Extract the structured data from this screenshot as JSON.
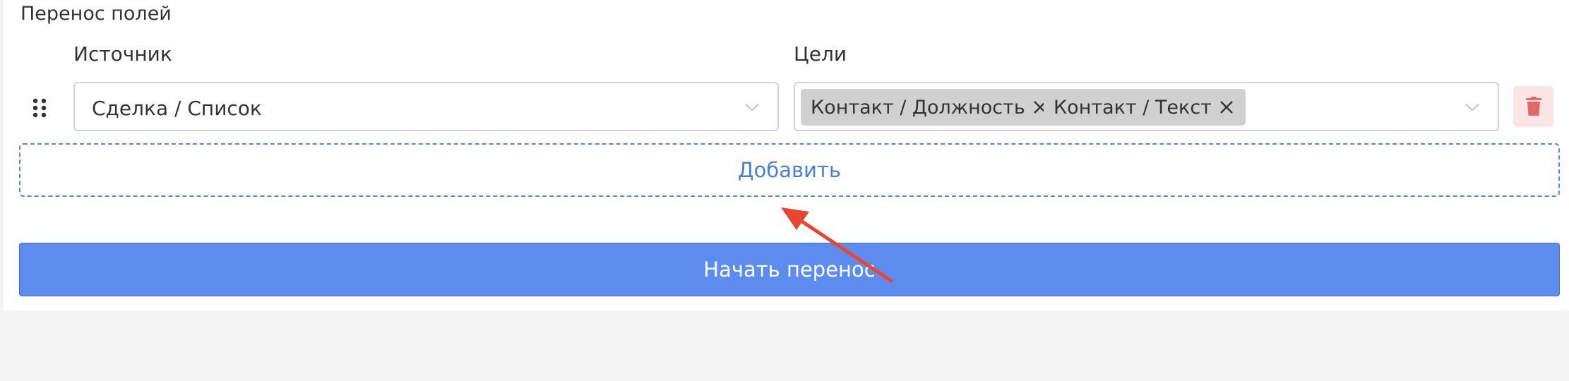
{
  "section": {
    "title": "Перенос полей"
  },
  "columns": {
    "source_label": "Источник",
    "targets_label": "Цели"
  },
  "row": {
    "source_value": "Сделка / Список",
    "targets": [
      {
        "label": "Контакт / Должность"
      },
      {
        "label": "Контакт / Текст"
      }
    ]
  },
  "actions": {
    "add_label": "Добавить",
    "start_label": "Начать перенос"
  },
  "colors": {
    "primary": "#5b8cee",
    "link": "#4b7fd6",
    "danger": "#e06a6a",
    "danger_bg": "#fbe4e4",
    "annotation_arrow": "#e8462f"
  }
}
